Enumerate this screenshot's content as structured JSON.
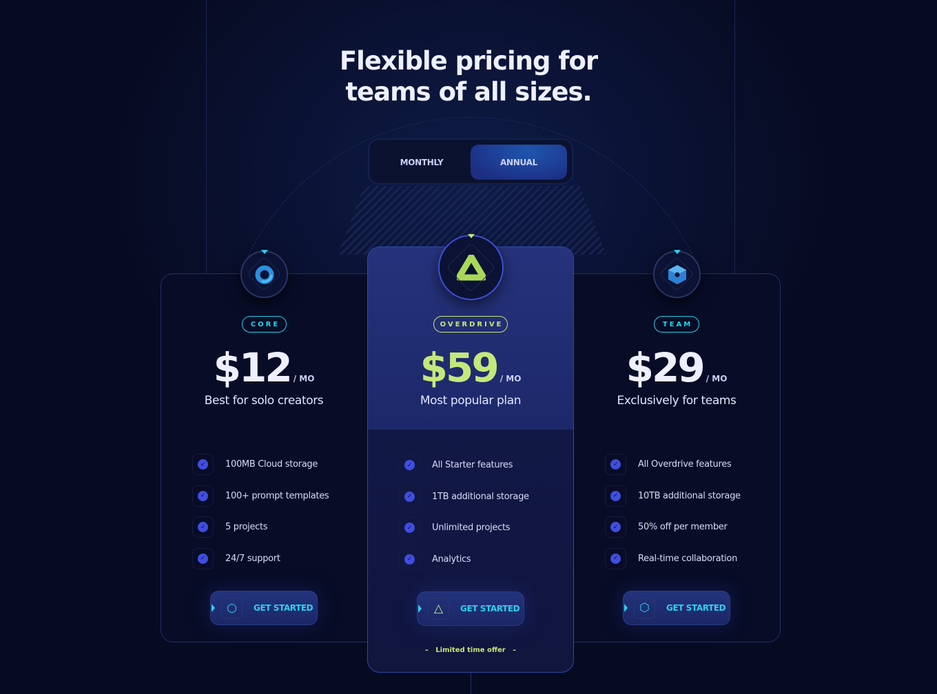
{
  "header": {
    "title_line1": "Flexible pricing for",
    "title_line2": "teams of all sizes."
  },
  "billing_toggle": {
    "options": [
      "MONTHLY",
      "ANNUAL"
    ],
    "selected": "ANNUAL"
  },
  "colors": {
    "background": "#070b22",
    "accent_cyan": "#2fd0f0",
    "accent_lime": "#c5e87a",
    "check": "#3f4ee0"
  },
  "plans": [
    {
      "badge": "CORE",
      "price": "$12",
      "period": "/ MO",
      "tagline": "Best for solo creators",
      "icon": "ring-icon",
      "features": [
        "100MB Cloud storage",
        "100+ prompt templates",
        "5 projects",
        "24/7 support"
      ],
      "cta": "GET STARTED",
      "cta_icon": "circle-icon"
    },
    {
      "badge": "OVERDRIVE",
      "price": "$59",
      "period": "/ MO",
      "tagline": "Most popular plan",
      "icon": "triangle-icon",
      "features": [
        "All Starter features",
        "1TB additional storage",
        "Unlimited projects",
        "Analytics"
      ],
      "cta": "GET STARTED",
      "cta_icon": "triangle-outline-icon",
      "note": "Limited time offer"
    },
    {
      "badge": "TEAM",
      "price": "$29",
      "period": "/ MO",
      "tagline": "Exclusively for teams",
      "icon": "hexagon-cube-icon",
      "features": [
        "All Overdrive features",
        "10TB additional storage",
        "50% off per member",
        "Real-time collaboration"
      ],
      "cta": "GET STARTED",
      "cta_icon": "hexagon-icon"
    }
  ]
}
